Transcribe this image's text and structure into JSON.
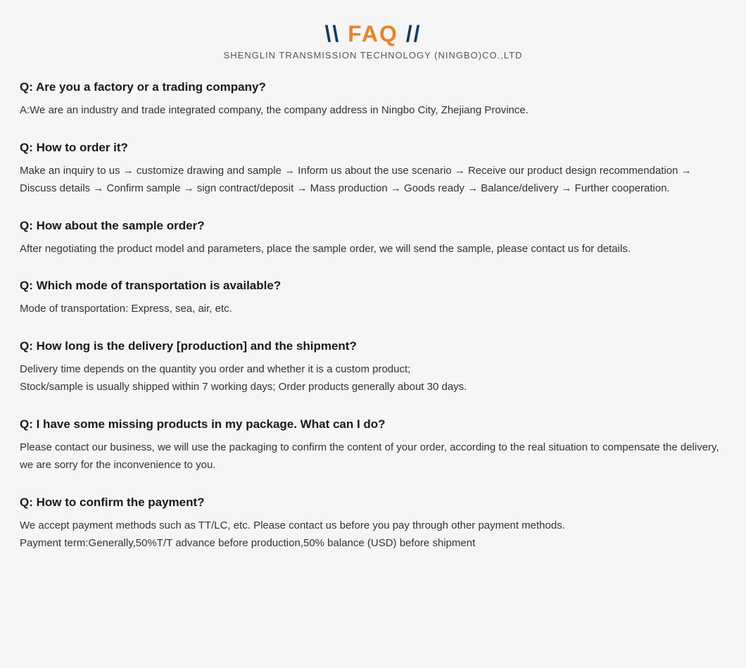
{
  "header": {
    "title_prefix": "\\ FAQ //",
    "title_slash_open": "\\\\",
    "title_faq": "FAQ",
    "title_slash_close": "//",
    "company": "SHENGLIN TRANSMISSION TECHNOLOGY (NINGBO)CO.,LTD"
  },
  "faqs": [
    {
      "id": 1,
      "question": "Q: Are you a factory or a trading company?",
      "answer": "A:We are an industry and trade integrated company, the company address in Ningbo City, Zhejiang Province."
    },
    {
      "id": 2,
      "question": "Q: How to order it?",
      "answer": "Make an inquiry to us → customize drawing and sample → Inform us about the use scenario → Receive our product design recommendation → Discuss details → Confirm sample → sign contract/deposit → Mass production → Goods ready → Balance/delivery → Further cooperation."
    },
    {
      "id": 3,
      "question": "Q: How about the sample order?",
      "answer": "After negotiating the product model and parameters, place the sample order, we will send the sample, please contact us for details."
    },
    {
      "id": 4,
      "question": "Q: Which mode of transportation is available?",
      "answer": "Mode of transportation: Express, sea, air, etc."
    },
    {
      "id": 5,
      "question": "Q: How long is the delivery [production] and the shipment?",
      "answer_line1": "Delivery time depends on the quantity you order and whether it is a custom product;",
      "answer_line2": "Stock/sample is usually shipped within 7 working days; Order products generally about 30 days."
    },
    {
      "id": 6,
      "question": "Q: I have some missing products in my package. What can I do?",
      "answer": "Please contact our business, we will use the packaging to confirm the content of your order, according to the real situation to compensate the delivery, we are sorry for the inconvenience to you."
    },
    {
      "id": 7,
      "question": "Q: How to confirm the payment?",
      "answer_line1": "We accept payment methods such as TT/LC, etc. Please contact us before you pay through other payment methods.",
      "answer_line2": "Payment term:Generally,50%T/T advance before production,50% balance (USD) before shipment"
    }
  ]
}
